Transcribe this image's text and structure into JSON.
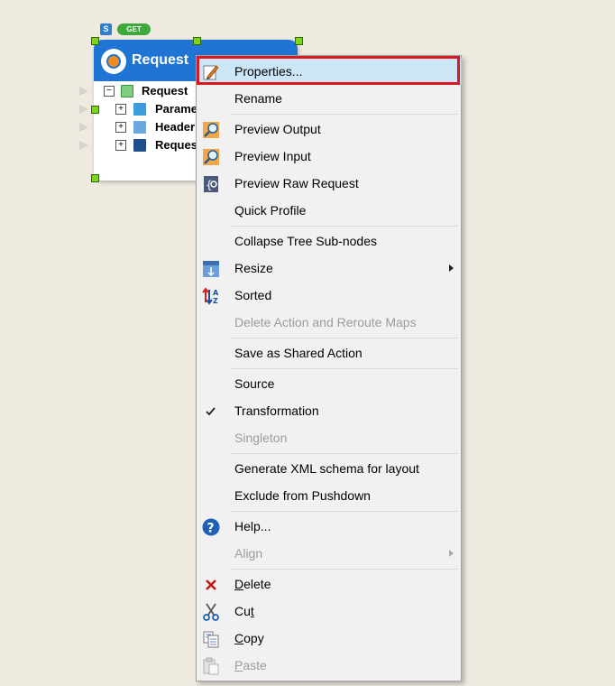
{
  "node": {
    "badge_s": "S",
    "badge_get": "GET",
    "title": "Request",
    "tree": {
      "root": "Request",
      "children": [
        "Parame",
        "Header",
        "Reques"
      ]
    }
  },
  "menu": {
    "properties": "Properties...",
    "rename": "Rename",
    "preview_output": "Preview Output",
    "preview_input": "Preview Input",
    "preview_raw_request": "Preview Raw Request",
    "quick_profile": "Quick Profile",
    "collapse_tree": "Collapse Tree Sub-nodes",
    "resize": "Resize",
    "sorted": "Sorted",
    "delete_action": "Delete Action and Reroute Maps",
    "save_shared": "Save as Shared Action",
    "source": "Source",
    "transformation": "Transformation",
    "singleton": "Singleton",
    "generate_xml": "Generate XML schema for layout",
    "exclude_pushdown": "Exclude from Pushdown",
    "help": "Help...",
    "align": "Align",
    "delete_pre": "D",
    "delete_post": "elete",
    "cut_pre": "Cu",
    "cut_u": "t",
    "copy_pre": "C",
    "copy_post": "opy",
    "paste_pre": "P",
    "paste_post": "aste"
  },
  "colors": {
    "highlight_frame": "#d91820",
    "node_header": "#1f74d4",
    "menu_background": "#f1f1f1"
  }
}
